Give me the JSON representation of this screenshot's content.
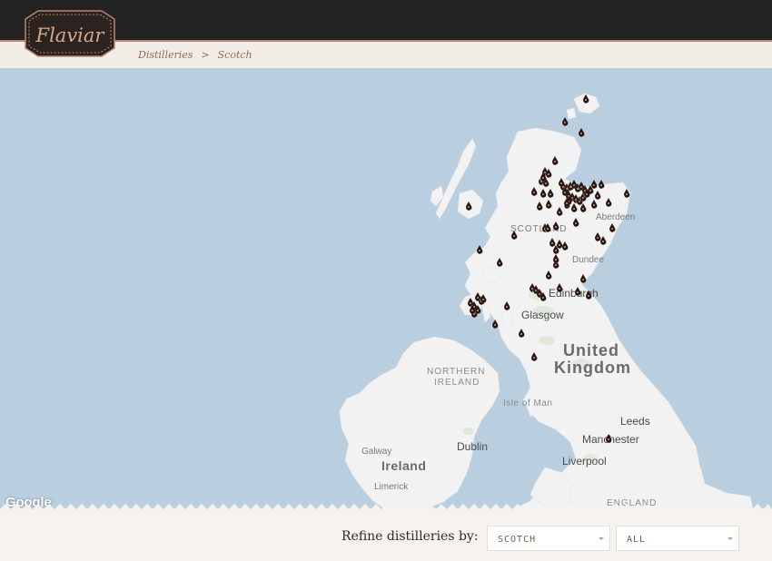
{
  "header": {
    "logo_text": "Flaviar",
    "breadcrumbs": [
      "Distilleries",
      "Scotch"
    ],
    "breadcrumb_separator": ">"
  },
  "map": {
    "attribution": "Google",
    "labels": {
      "scotland": "SCOTLAND",
      "aberdeen": "Aberdeen",
      "dundee": "Dundee",
      "edinburgh": "Edinburgh",
      "glasgow": "Glasgow",
      "united_kingdom_1": "United",
      "united_kingdom_2": "Kingdom",
      "northern_ireland_1": "NORTHERN",
      "northern_ireland_2": "IRELAND",
      "isle_of_man": "Isle of Man",
      "leeds": "Leeds",
      "manchester": "Manchester",
      "dublin": "Dublin",
      "galway": "Galway",
      "ireland": "Ireland",
      "liverpool": "Liverpool",
      "limerick": "Limerick",
      "england": "ENGLAND"
    },
    "marker_count": 81
  },
  "filters": {
    "label": "Refine distilleries by:",
    "type_value": "SCOTCH",
    "region_value": "ALL"
  },
  "colors": {
    "topbar": "#232323",
    "accent": "#b7886d",
    "water": "#b9cfe0",
    "land": "#f2f2f2",
    "marker": "#2a1612"
  }
}
